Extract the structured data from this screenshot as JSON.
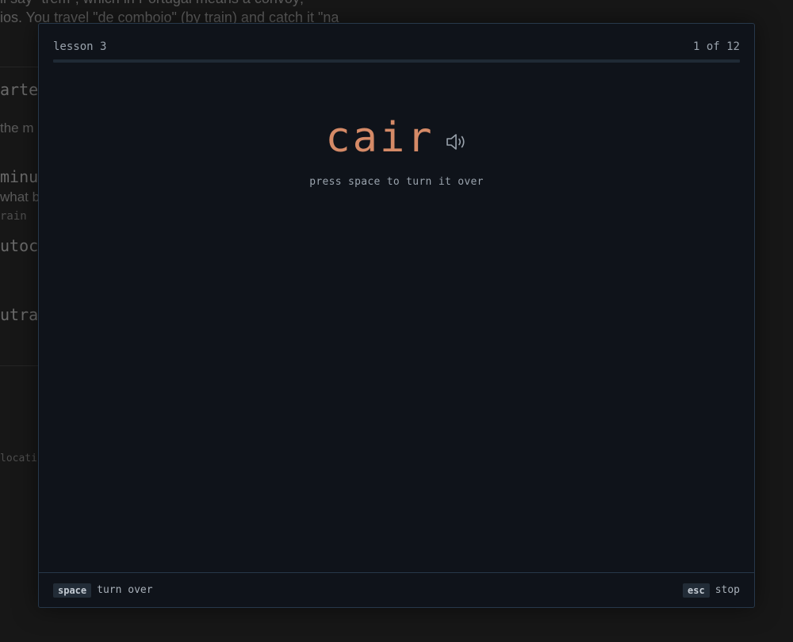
{
  "background": {
    "prose_1": "ll say \"trem\", which in Portugal means a convoy;",
    "prose_2": "ios. You travel \"de comboio\" (by train) and catch it \"na",
    "heading_1": "arte",
    "fragment_1": "the m",
    "heading_2": " minu",
    "fragment_2": "what b",
    "small_1": "rain",
    "heading_3": "utoca",
    "heading_4": "utra",
    "small_2": "locati"
  },
  "modal": {
    "lesson_label": "lesson 3",
    "counter": "1 of 12",
    "progress": 0.0,
    "word": "cair",
    "speaker_icon": "speaker-icon",
    "hint": "press space to turn it over",
    "footer": {
      "space_key": "space",
      "space_action": "turn over",
      "esc_key": "esc",
      "esc_action": "stop"
    }
  }
}
